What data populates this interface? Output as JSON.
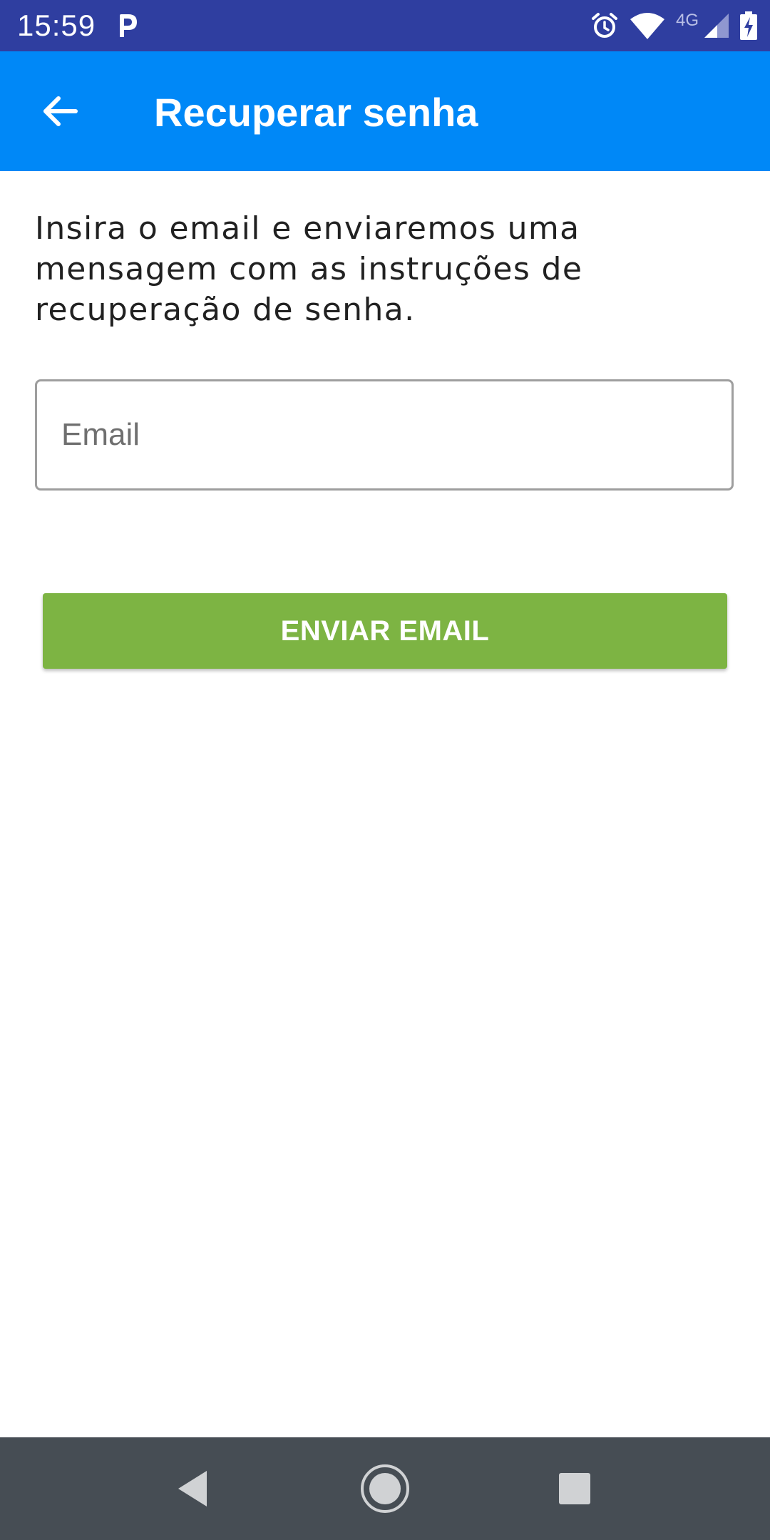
{
  "status_bar": {
    "time": "15:59",
    "network_label": "4G",
    "icons": [
      "parking-app-icon",
      "alarm-icon",
      "wifi-icon",
      "cell-signal-icon",
      "battery-charging-icon"
    ]
  },
  "app_bar": {
    "title": "Recuperar senha",
    "back_icon": "arrow-back-icon",
    "background": "#0088f7"
  },
  "main": {
    "instructions": "Insira o email e enviaremos uma mensagem com as instruções de recuperação de senha.",
    "email_field": {
      "placeholder": "Email",
      "value": ""
    },
    "send_button": {
      "label": "ENVIAR EMAIL",
      "color": "#7db443"
    }
  },
  "nav_bar": {
    "icons": [
      "nav-back-icon",
      "nav-home-icon",
      "nav-recents-icon"
    ]
  },
  "colors": {
    "status_bar": "#2f3ea0",
    "nav_bar": "#464d54",
    "text": "#212121"
  }
}
